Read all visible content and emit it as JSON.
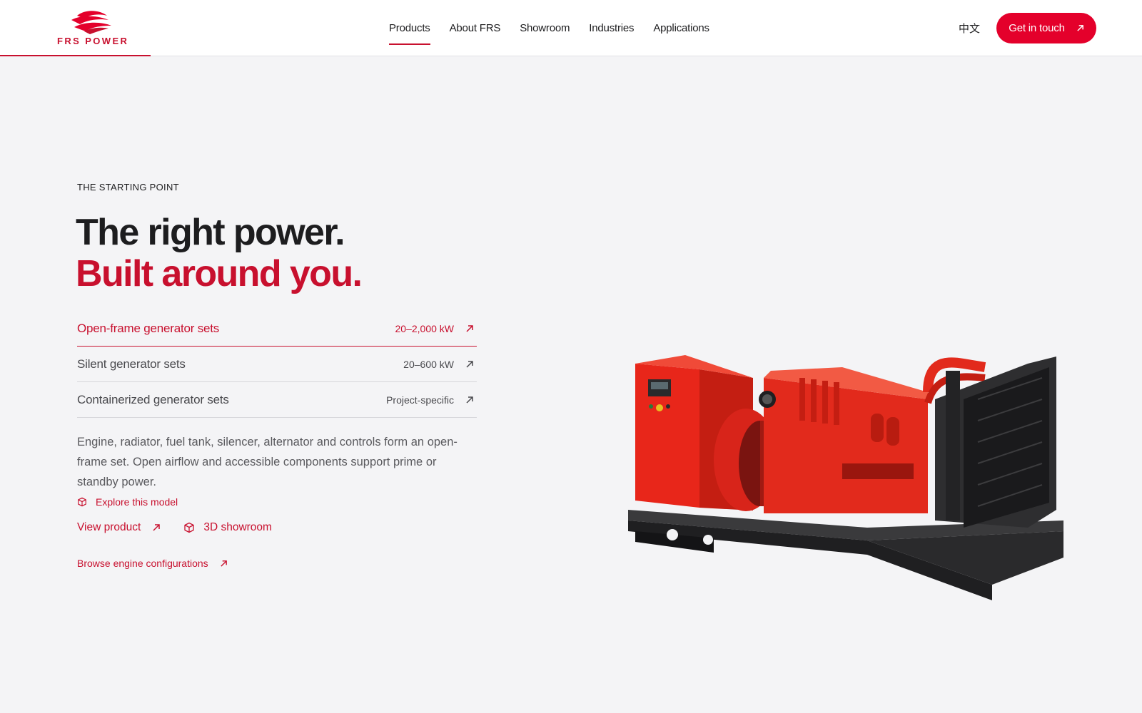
{
  "brand": {
    "name": "FRS POWER",
    "accent_color": "#c8102e"
  },
  "nav": {
    "items": [
      {
        "label": "Products",
        "active": true
      },
      {
        "label": "About FRS"
      },
      {
        "label": "Showroom"
      },
      {
        "label": "Industries"
      },
      {
        "label": "Applications"
      }
    ],
    "language": "中文",
    "cta_label": "Get in touch"
  },
  "hero": {
    "eyebrow": "THE STARTING POINT",
    "line1": "The right power.",
    "line2": "Built around you."
  },
  "products": [
    {
      "label": "Open-frame generator sets",
      "spec": "20–2,000 kW",
      "active": true
    },
    {
      "label": "Silent generator sets",
      "spec": "20–600 kW"
    },
    {
      "label": "Containerized generator sets",
      "spec": "Project-specific"
    }
  ],
  "detail": {
    "description": "Engine, radiator, fuel tank, silencer, alternator and controls form an open-frame set. Open airflow and accessible components support prime or standby power.",
    "explore_label": "Explore this model",
    "view_product_label": "View product",
    "showroom_label": "3D showroom",
    "browse_label": "Browse engine configurations"
  },
  "icons": {
    "arrow": "arrow-up-right-icon",
    "cube": "cube-icon"
  }
}
